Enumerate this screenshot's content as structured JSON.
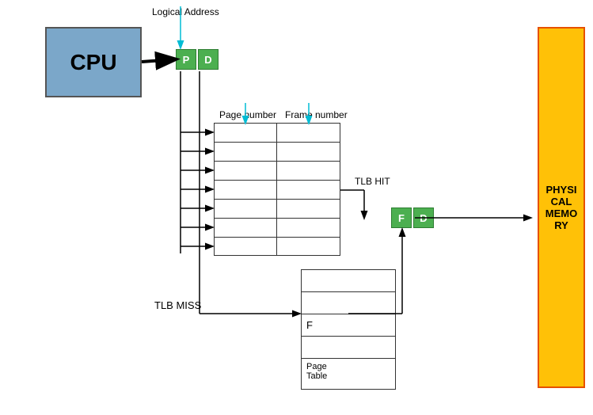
{
  "cpu": {
    "label": "CPU"
  },
  "pd_box": {
    "p_label": "P",
    "d_label": "D"
  },
  "fd_box": {
    "f_label": "F",
    "d_label": "D"
  },
  "labels": {
    "logical_address": "Logical Address",
    "page_number": "Page number",
    "frame_number": "Frame number",
    "tlb_hit": "TLB HIT",
    "tlb_miss": "TLB MISS",
    "page_table": "Page\nTable",
    "f_cell": "F",
    "physical_memory_line1": "PHYSICAL",
    "physical_memory_line2": "MEMORY"
  },
  "tlb_rows": 7,
  "page_table_rows": 5
}
